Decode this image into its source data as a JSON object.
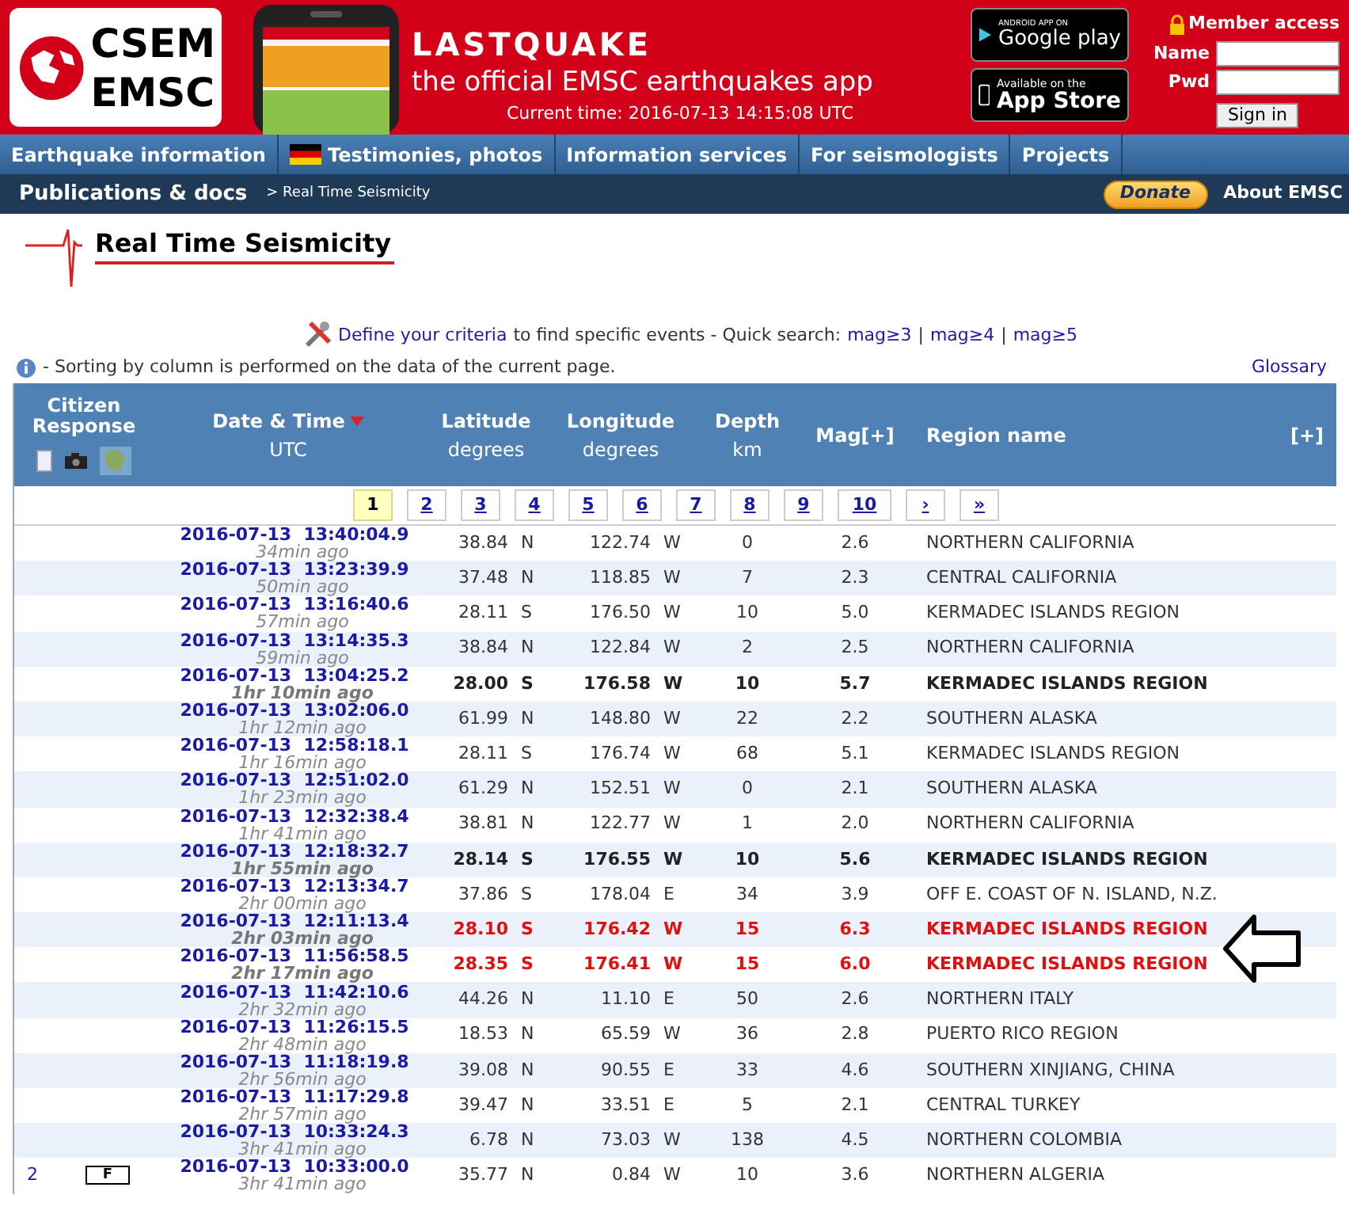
{
  "header": {
    "logo_top": "CSEM",
    "logo_bottom": "EMSC",
    "app_title": "LASTQUAKE",
    "app_subtitle": "the official EMSC earthquakes app",
    "current_time": "Current time: 2016-07-13 14:15:08 UTC",
    "google_play": {
      "small": "ANDROID APP ON",
      "big": "Google play"
    },
    "app_store": {
      "small": "Available on the",
      "big": "App Store"
    },
    "member_access": "Member access",
    "name_label": "Name",
    "pwd_label": "Pwd",
    "sign_in": "Sign in"
  },
  "nav": [
    {
      "label": "Earthquake information",
      "kind": "plain"
    },
    {
      "label": "Testimonies, photos",
      "kind": "flag"
    },
    {
      "label": "Information services",
      "kind": "plain"
    },
    {
      "label": "For seismologists",
      "kind": "plain"
    },
    {
      "label": "Projects",
      "kind": "plain"
    },
    {
      "label": "Publications & docs",
      "kind": "plain"
    }
  ],
  "breadcrumb": "> Real Time Seismicity",
  "donate": "Donate",
  "about": "About EMSC",
  "page_title": "Real Time Seismicity",
  "criteria": {
    "link": "Define your criteria",
    "text": "to find specific events - Quick search:",
    "quick": [
      "mag≥3",
      "mag≥4",
      "mag≥5"
    ],
    "separator": "|"
  },
  "note": "- Sorting by column is performed on the data of the current page.",
  "glossary": "Glossary",
  "columns": {
    "citizen": "Citizen Response",
    "date": "Date & Time",
    "date_sub": "UTC",
    "lat": "Latitude",
    "lat_sub": "degrees",
    "lon": "Longitude",
    "lon_sub": "degrees",
    "depth": "Depth",
    "depth_sub": "km",
    "mag": "Mag[+]",
    "region": "Region name",
    "more": "[+]"
  },
  "pages": [
    {
      "label": "1",
      "selected": true
    },
    {
      "label": "2",
      "selected": false
    },
    {
      "label": "3",
      "selected": false
    },
    {
      "label": "4",
      "selected": false
    },
    {
      "label": "5",
      "selected": false
    },
    {
      "label": "6",
      "selected": false
    },
    {
      "label": "7",
      "selected": false
    },
    {
      "label": "8",
      "selected": false
    },
    {
      "label": "9",
      "selected": false
    },
    {
      "label": "10",
      "selected": false
    },
    {
      "label": "›",
      "selected": false
    },
    {
      "label": "»",
      "selected": false
    }
  ],
  "rows": [
    {
      "kind": "normal",
      "date": "2016-07-13",
      "time": "13:40:04.9",
      "ago": "34min ago",
      "lat": "38.84",
      "lat_dir": "N",
      "lon": "122.74",
      "lon_dir": "W",
      "depth": "0",
      "mag": "2.6",
      "region": "NORTHERN CALIFORNIA"
    },
    {
      "kind": "normal",
      "date": "2016-07-13",
      "time": "13:23:39.9",
      "ago": "50min ago",
      "lat": "37.48",
      "lat_dir": "N",
      "lon": "118.85",
      "lon_dir": "W",
      "depth": "7",
      "mag": "2.3",
      "region": "CENTRAL CALIFORNIA"
    },
    {
      "kind": "normal",
      "date": "2016-07-13",
      "time": "13:16:40.6",
      "ago": "57min ago",
      "lat": "28.11",
      "lat_dir": "S",
      "lon": "176.50",
      "lon_dir": "W",
      "depth": "10",
      "mag": "5.0",
      "region": "KERMADEC ISLANDS REGION"
    },
    {
      "kind": "normal",
      "date": "2016-07-13",
      "time": "13:14:35.3",
      "ago": "59min ago",
      "lat": "38.84",
      "lat_dir": "N",
      "lon": "122.84",
      "lon_dir": "W",
      "depth": "2",
      "mag": "2.5",
      "region": "NORTHERN CALIFORNIA"
    },
    {
      "kind": "strong",
      "date": "2016-07-13",
      "time": "13:04:25.2",
      "ago": "1hr 10min ago",
      "lat": "28.00",
      "lat_dir": "S",
      "lon": "176.58",
      "lon_dir": "W",
      "depth": "10",
      "mag": "5.7",
      "region": "KERMADEC ISLANDS REGION"
    },
    {
      "kind": "normal",
      "date": "2016-07-13",
      "time": "13:02:06.0",
      "ago": "1hr 12min ago",
      "lat": "61.99",
      "lat_dir": "N",
      "lon": "148.80",
      "lon_dir": "W",
      "depth": "22",
      "mag": "2.2",
      "region": "SOUTHERN ALASKA"
    },
    {
      "kind": "normal",
      "date": "2016-07-13",
      "time": "12:58:18.1",
      "ago": "1hr 16min ago",
      "lat": "28.11",
      "lat_dir": "S",
      "lon": "176.74",
      "lon_dir": "W",
      "depth": "68",
      "mag": "5.1",
      "region": "KERMADEC ISLANDS REGION"
    },
    {
      "kind": "normal",
      "date": "2016-07-13",
      "time": "12:51:02.0",
      "ago": "1hr 23min ago",
      "lat": "61.29",
      "lat_dir": "N",
      "lon": "152.51",
      "lon_dir": "W",
      "depth": "0",
      "mag": "2.1",
      "region": "SOUTHERN ALASKA"
    },
    {
      "kind": "normal",
      "date": "2016-07-13",
      "time": "12:32:38.4",
      "ago": "1hr 41min ago",
      "lat": "38.81",
      "lat_dir": "N",
      "lon": "122.77",
      "lon_dir": "W",
      "depth": "1",
      "mag": "2.0",
      "region": "NORTHERN CALIFORNIA"
    },
    {
      "kind": "strong",
      "date": "2016-07-13",
      "time": "12:18:32.7",
      "ago": "1hr 55min ago",
      "lat": "28.14",
      "lat_dir": "S",
      "lon": "176.55",
      "lon_dir": "W",
      "depth": "10",
      "mag": "5.6",
      "region": "KERMADEC ISLANDS REGION"
    },
    {
      "kind": "normal",
      "date": "2016-07-13",
      "time": "12:13:34.7",
      "ago": "2hr 00min ago",
      "lat": "37.86",
      "lat_dir": "S",
      "lon": "178.04",
      "lon_dir": "E",
      "depth": "34",
      "mag": "3.9",
      "region": "OFF E. COAST OF N. ISLAND, N.Z."
    },
    {
      "kind": "alert",
      "date": "2016-07-13",
      "time": "12:11:13.4",
      "ago": "2hr 03min ago",
      "lat": "28.10",
      "lat_dir": "S",
      "lon": "176.42",
      "lon_dir": "W",
      "depth": "15",
      "mag": "6.3",
      "region": "KERMADEC ISLANDS REGION"
    },
    {
      "kind": "alert",
      "date": "2016-07-13",
      "time": "11:56:58.5",
      "ago": "2hr 17min ago",
      "lat": "28.35",
      "lat_dir": "S",
      "lon": "176.41",
      "lon_dir": "W",
      "depth": "15",
      "mag": "6.0",
      "region": "KERMADEC ISLANDS REGION"
    },
    {
      "kind": "normal",
      "date": "2016-07-13",
      "time": "11:42:10.6",
      "ago": "2hr 32min ago",
      "lat": "44.26",
      "lat_dir": "N",
      "lon": "11.10",
      "lon_dir": "E",
      "depth": "50",
      "mag": "2.6",
      "region": "NORTHERN ITALY"
    },
    {
      "kind": "normal",
      "date": "2016-07-13",
      "time": "11:26:15.5",
      "ago": "2hr 48min ago",
      "lat": "18.53",
      "lat_dir": "N",
      "lon": "65.59",
      "lon_dir": "W",
      "depth": "36",
      "mag": "2.8",
      "region": "PUERTO RICO REGION"
    },
    {
      "kind": "normal",
      "date": "2016-07-13",
      "time": "11:18:19.8",
      "ago": "2hr 56min ago",
      "lat": "39.08",
      "lat_dir": "N",
      "lon": "90.55",
      "lon_dir": "E",
      "depth": "33",
      "mag": "4.6",
      "region": "SOUTHERN XINJIANG, CHINA"
    },
    {
      "kind": "normal",
      "date": "2016-07-13",
      "time": "11:17:29.8",
      "ago": "2hr 57min ago",
      "lat": "39.47",
      "lat_dir": "N",
      "lon": "33.51",
      "lon_dir": "E",
      "depth": "5",
      "mag": "2.1",
      "region": "CENTRAL TURKEY"
    },
    {
      "kind": "normal",
      "date": "2016-07-13",
      "time": "10:33:24.3",
      "ago": "3hr 41min ago",
      "lat": "6.78",
      "lat_dir": "N",
      "lon": "73.03",
      "lon_dir": "W",
      "depth": "138",
      "mag": "4.5",
      "region": "NORTHERN COLOMBIA"
    },
    {
      "kind": "normal",
      "date": "2016-07-13",
      "time": "10:33:00.0",
      "ago": "3hr 41min ago",
      "lat": "35.77",
      "lat_dir": "N",
      "lon": "0.84",
      "lon_dir": "W",
      "depth": "10",
      "mag": "3.6",
      "region": "NORTHERN ALGERIA",
      "testimonies": "2",
      "felt": "F"
    }
  ]
}
